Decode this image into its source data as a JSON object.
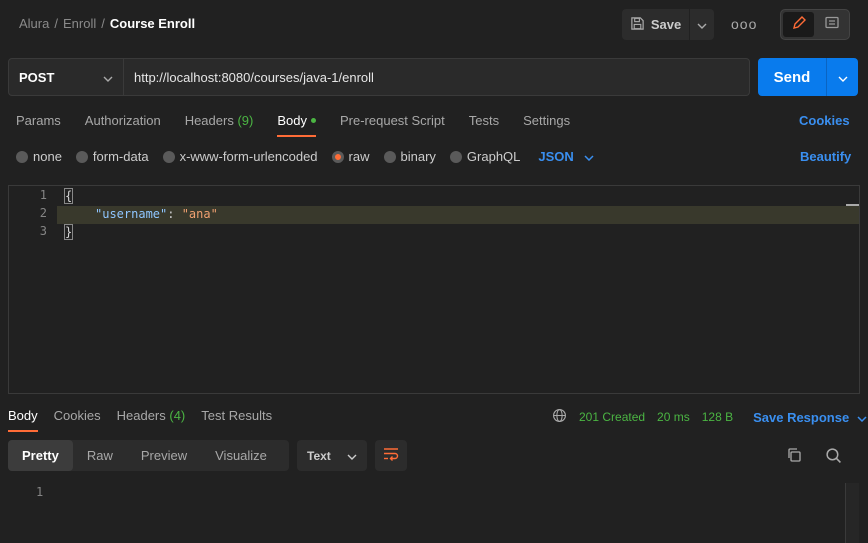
{
  "breadcrumb": {
    "root": "Alura",
    "sep": "/",
    "folder": "Enroll",
    "current": "Course Enroll"
  },
  "toolbar": {
    "save_label": "Save",
    "more_label": "ooo"
  },
  "request": {
    "method": "POST",
    "url": "http://localhost:8080/courses/java-1/enroll",
    "send_label": "Send"
  },
  "req_tabs": {
    "params": "Params",
    "authorization": "Authorization",
    "headers": "Headers",
    "headers_count": "(9)",
    "body": "Body",
    "prerequest": "Pre-request Script",
    "tests": "Tests",
    "settings": "Settings",
    "cookies": "Cookies"
  },
  "body_types": {
    "none": "none",
    "form_data": "form-data",
    "urlencoded": "x-www-form-urlencoded",
    "raw": "raw",
    "binary": "binary",
    "graphql": "GraphQL",
    "format": "JSON",
    "beautify": "Beautify"
  },
  "editor": {
    "lines": [
      "1",
      "2",
      "3"
    ],
    "open_brace": "{",
    "key": "\"username\"",
    "colon": ": ",
    "value": "\"ana\"",
    "close_brace": "}"
  },
  "response": {
    "tabs": {
      "body": "Body",
      "cookies": "Cookies",
      "headers": "Headers",
      "headers_count": "(4)",
      "test_results": "Test Results"
    },
    "status": "201 Created",
    "time": "20 ms",
    "size": "128 B",
    "save_response": "Save Response",
    "views": {
      "pretty": "Pretty",
      "raw": "Raw",
      "preview": "Preview",
      "visualize": "Visualize"
    },
    "format": "Text",
    "line": "1"
  },
  "colors": {
    "accent": "#ff6c37",
    "primary": "#097bed",
    "success": "#4bb543",
    "link": "#3a8ff0"
  }
}
